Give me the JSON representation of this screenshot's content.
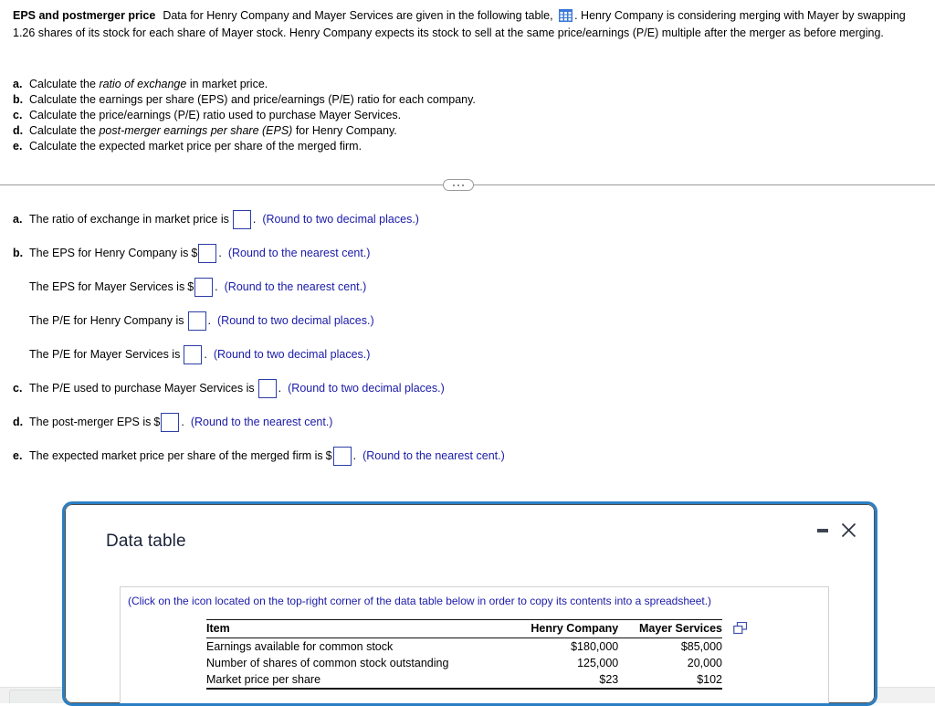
{
  "question": {
    "title": "EPS and postmerger price",
    "body_part1": "Data for Henry Company and Mayer Services are given in the following table,",
    "table_icon": "table-grid-icon",
    "body_part2": ". Henry Company is considering merging with Mayer by swapping 1.26 shares of its stock for each share of Mayer stock. Henry Company expects its stock to sell at the same price/earnings (P/E) multiple after the merger as before merging."
  },
  "tasks": [
    {
      "letter": "a.",
      "pre": "Calculate the ",
      "em": "ratio of exchange",
      "post": " in market price."
    },
    {
      "letter": "b.",
      "pre": "Calculate the earnings per share (EPS) and price/earnings (P/E) ratio for each company.",
      "em": "",
      "post": ""
    },
    {
      "letter": "c.",
      "pre": "Calculate the price/earnings (P/E) ratio used to purchase Mayer Services.",
      "em": "",
      "post": ""
    },
    {
      "letter": "d.",
      "pre": "Calculate the ",
      "em": "post-merger earnings per share (EPS)",
      "post": " for Henry Company."
    },
    {
      "letter": "e.",
      "pre": "Calculate the expected market price per share of the merged firm.",
      "em": "",
      "post": ""
    }
  ],
  "divider": {
    "ellipsis": "..."
  },
  "answers": [
    {
      "letter": "a.",
      "text": "The ratio of exchange in market price is",
      "dollar": "",
      "note": "(Round to two decimal places.)"
    },
    {
      "letter": "b.",
      "text": "The EPS for Henry Company is",
      "dollar": "$",
      "note": "(Round to the nearest cent.)"
    },
    {
      "letter": "",
      "text": "The EPS for Mayer Services is",
      "dollar": "$",
      "note": "(Round to the nearest cent.)"
    },
    {
      "letter": "",
      "text": "The P/E for Henry Company is",
      "dollar": "",
      "note": "(Round to two decimal places.)"
    },
    {
      "letter": "",
      "text": "The P/E for Mayer Services is",
      "dollar": "",
      "note": "(Round to two decimal places.)"
    },
    {
      "letter": "c.",
      "text": "The P/E used to purchase Mayer Services is",
      "dollar": "",
      "note": "(Round to two decimal places.)"
    },
    {
      "letter": "d.",
      "text": "The post-merger EPS is",
      "dollar": "$",
      "note": "(Round to the nearest cent.)"
    },
    {
      "letter": "e.",
      "text": "The expected market price per share of the merged firm is",
      "dollar": "$",
      "note": "(Round to the nearest cent.)"
    }
  ],
  "dialog": {
    "title": "Data table",
    "minimize_label": "minimize-icon",
    "close_label": "close-icon",
    "copy_hint": "(Click on the icon located on the top-right corner of the data table below in order to copy its contents into a spreadsheet.)",
    "copy_icon": "copy-to-spreadsheet-icon",
    "table": {
      "headers": [
        "Item",
        "Henry Company",
        "Mayer Services"
      ],
      "rows": [
        [
          "Earnings available for common stock",
          "$180,000",
          "$85,000"
        ],
        [
          "Number of shares of common stock outstanding",
          "125,000",
          "20,000"
        ],
        [
          "Market price per share",
          "$23",
          "$102"
        ]
      ]
    }
  },
  "colors": {
    "dialog_border": "#2a7fc4",
    "link_blue": "#1a1aa8",
    "input_border": "#2c3ea8",
    "icon_blue": "#3b78d8"
  }
}
